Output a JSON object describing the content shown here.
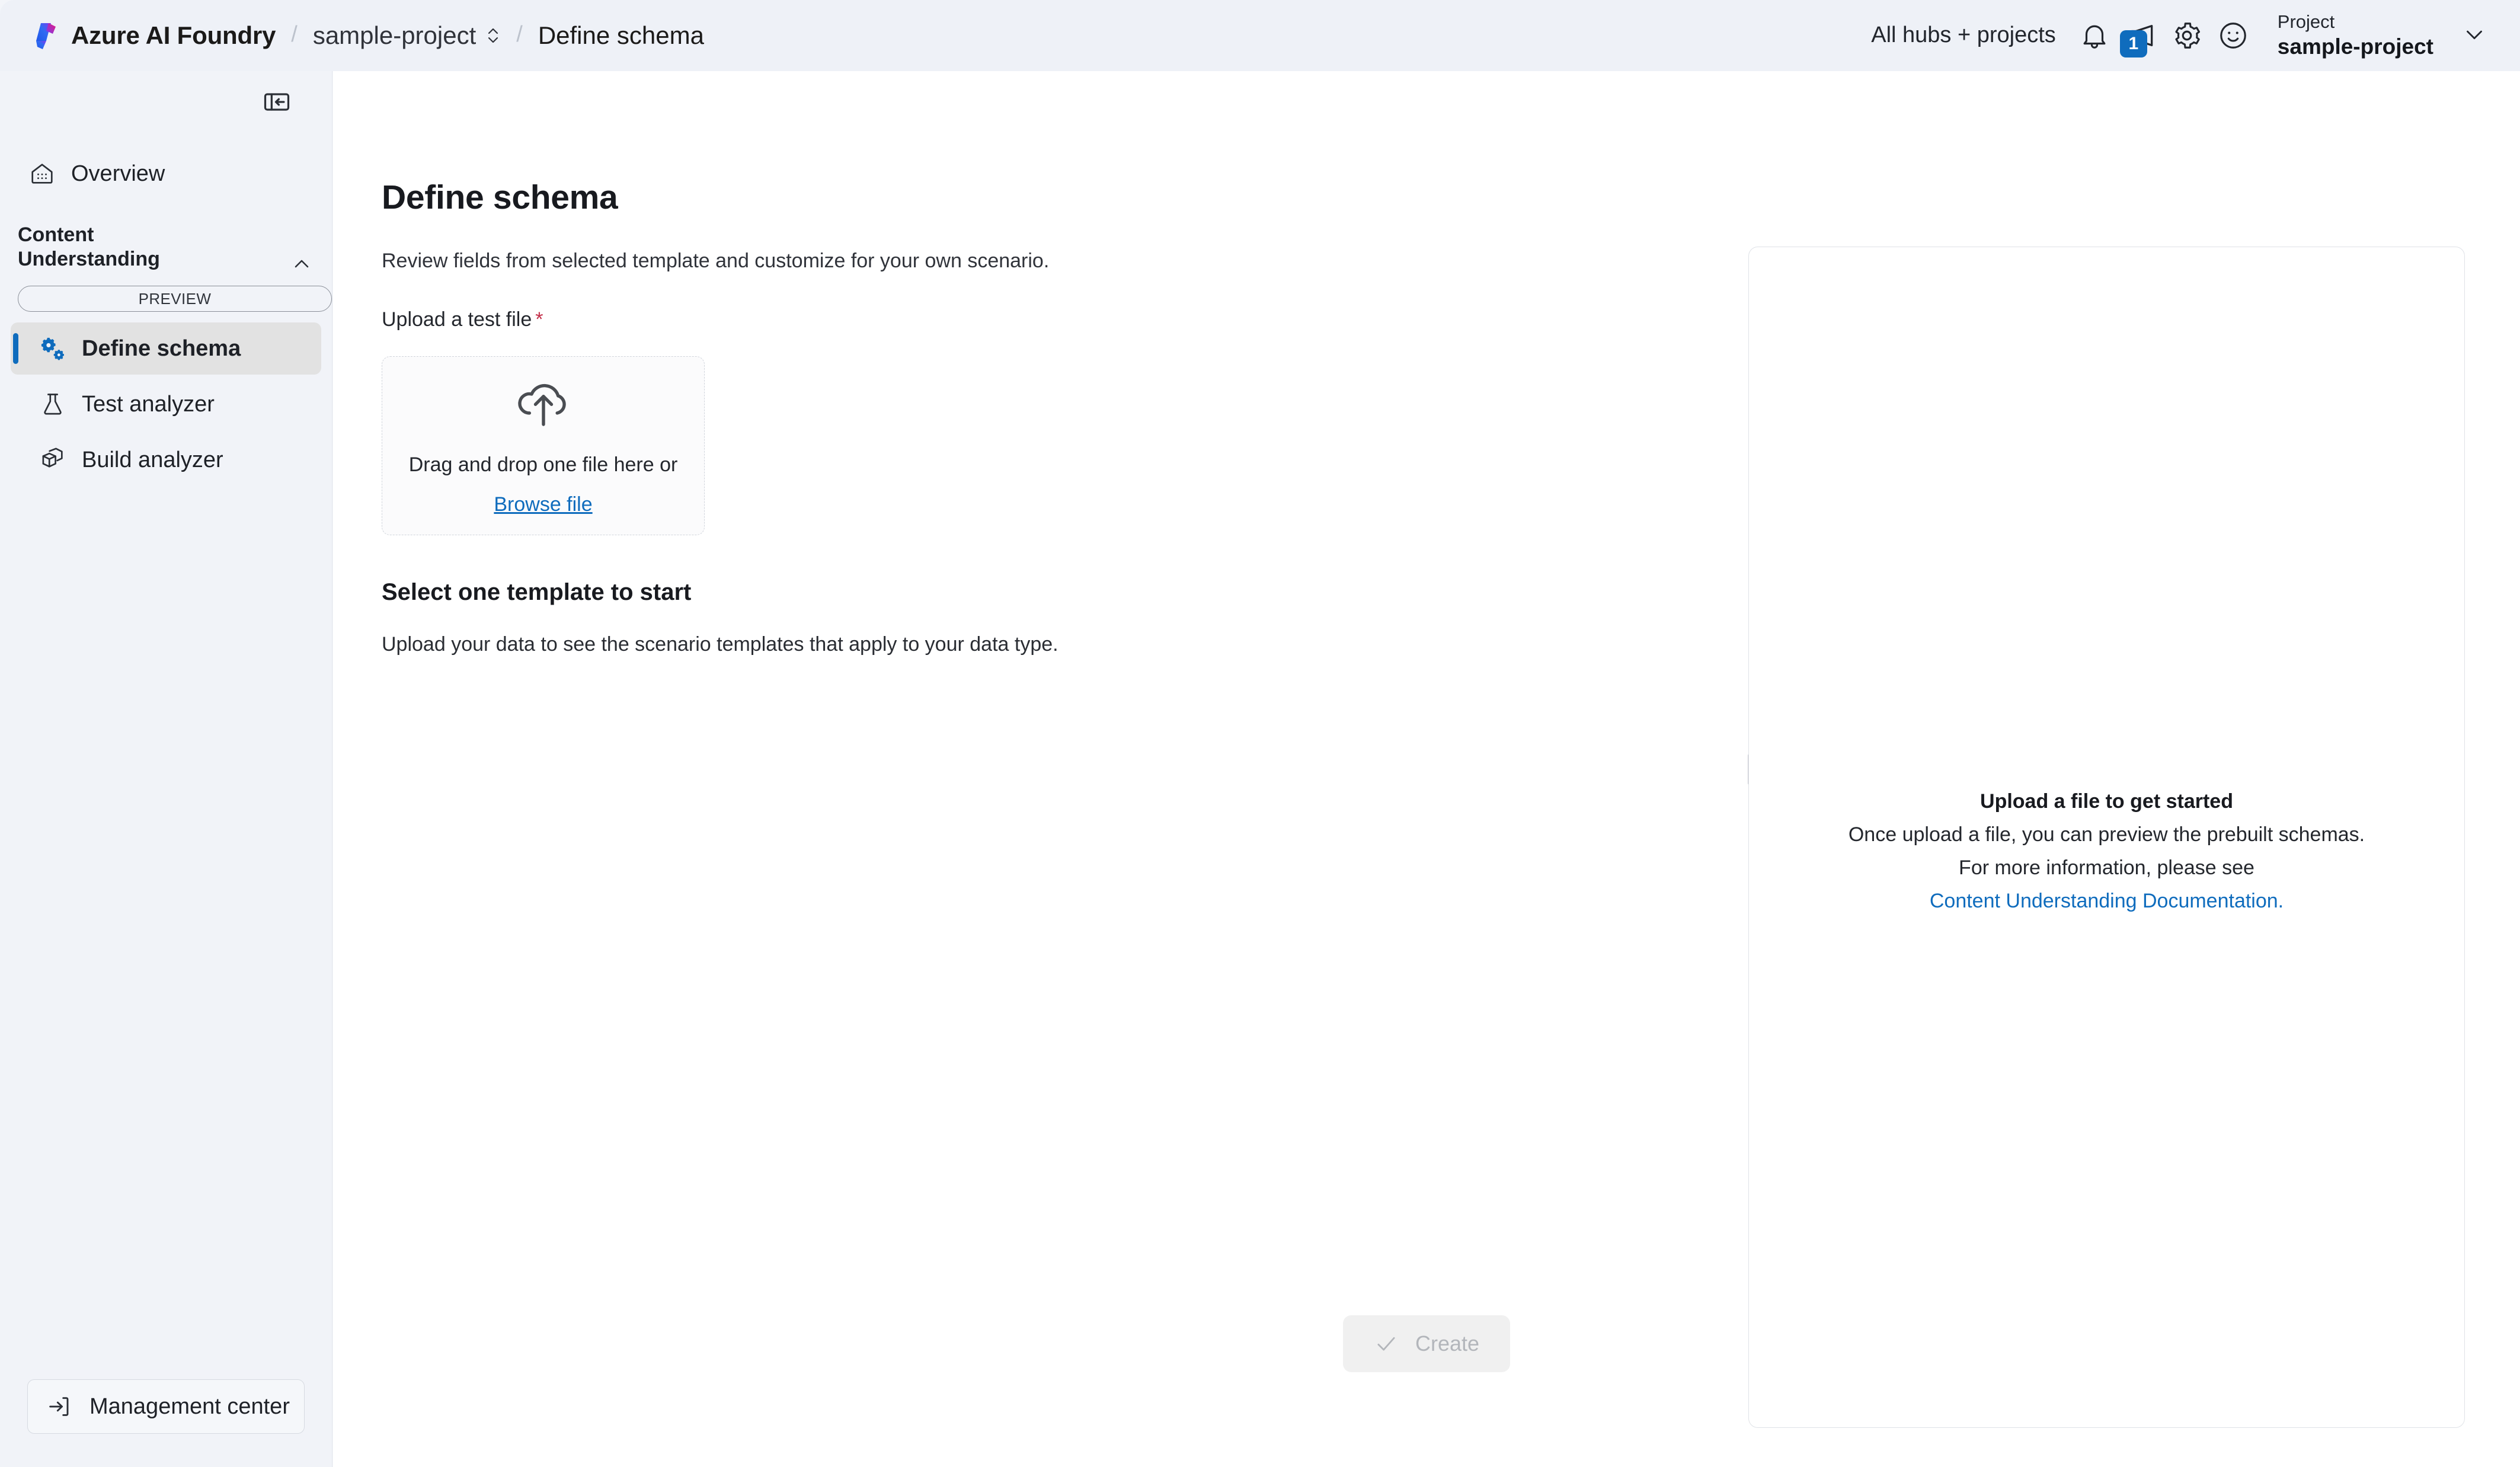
{
  "header": {
    "brand": "Azure AI Foundry",
    "breadcrumb_project": "sample-project",
    "breadcrumb_current": "Define schema",
    "hubs_link": "All hubs + projects",
    "notification_badge": "1",
    "project_label": "Project",
    "project_value": "sample-project",
    "icons": {
      "logo": "azure-ai-foundry-logo",
      "updown": "up-down-chevron-icon",
      "bell": "bell-icon",
      "announcement": "megaphone-icon",
      "settings": "gear-icon",
      "feedback": "smiley-icon",
      "chevron": "chevron-down-icon"
    }
  },
  "sidebar": {
    "collapse_tooltip": "Collapse navigation",
    "overview_label": "Overview",
    "group": {
      "title": "Content Understanding",
      "badge": "PREVIEW"
    },
    "items": [
      {
        "label": "Define schema",
        "selected": true
      },
      {
        "label": "Test analyzer",
        "selected": false
      },
      {
        "label": "Build analyzer",
        "selected": false
      }
    ],
    "management_center": "Management center"
  },
  "main": {
    "title": "Define schema",
    "subtitle": "Review fields from selected template and customize for your own scenario.",
    "upload_label": "Upload a test file",
    "required_mark": "*",
    "dropzone": {
      "text": "Drag and drop one file here or",
      "browse_link": "Browse file"
    },
    "template_section": {
      "title": "Select one template to start",
      "description": "Upload your data to see the scenario templates that apply to your data type."
    },
    "create_button": "Create"
  },
  "preview": {
    "title": "Upload a file to get started",
    "line1": "Once upload a file, you can preview the prebuilt schemas.",
    "line2": "For more information, please see",
    "link": "Content Understanding Documentation."
  },
  "colors": {
    "accent": "#0f6cbd",
    "required": "#c4314b",
    "header_bg": "#eef1f7",
    "sidebar_bg": "#f1f3f8",
    "selected_item_bg": "#e2e2e2"
  }
}
